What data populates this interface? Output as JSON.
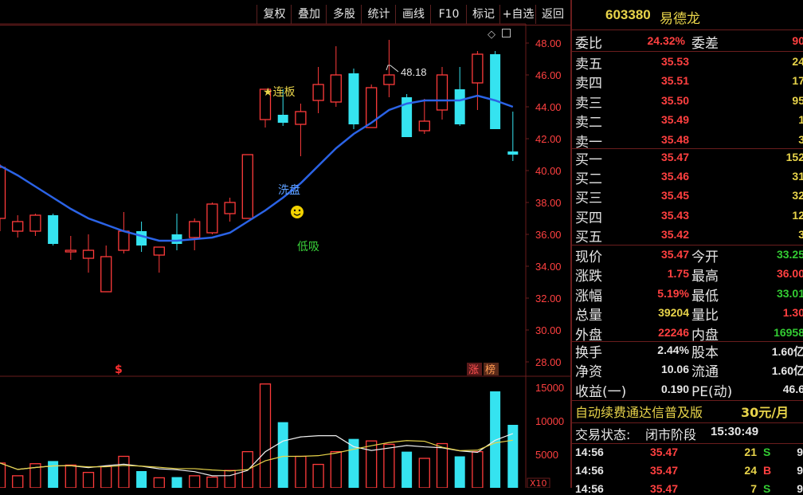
{
  "toolbar": {
    "items": [
      "复权",
      "叠加",
      "多股",
      "统计",
      "画线",
      "F10",
      "标记",
      "+自选",
      "返回"
    ]
  },
  "stock": {
    "code": "603380",
    "name": "易德龙"
  },
  "chart_data": {
    "type": "candlestick",
    "price_axis": {
      "ticks": [
        "48.00",
        "46.00",
        "44.00",
        "42.00",
        "40.00",
        "38.00",
        "36.00",
        "34.00",
        "32.00",
        "30.00",
        "28.00"
      ],
      "ylim": [
        27.2,
        49.2
      ]
    },
    "volume_axis": {
      "ticks": [
        "15000",
        "10000",
        "5000"
      ],
      "unit_label": "X10"
    },
    "candles": [
      {
        "o": 37.0,
        "h": 40.4,
        "l": 36.2,
        "c": 40.2
      },
      {
        "o": 36.2,
        "h": 37.2,
        "l": 35.8,
        "c": 36.8
      },
      {
        "o": 36.2,
        "h": 37.3,
        "l": 35.9,
        "c": 37.2
      },
      {
        "o": 37.2,
        "h": 37.3,
        "l": 35.3,
        "c": 35.4
      },
      {
        "o": 34.9,
        "h": 35.9,
        "l": 34.4,
        "c": 35.0
      },
      {
        "o": 34.5,
        "h": 36.0,
        "l": 33.6,
        "c": 35.0
      },
      {
        "o": 32.4,
        "h": 35.3,
        "l": 32.4,
        "c": 34.6
      },
      {
        "o": 35.0,
        "h": 37.4,
        "l": 34.8,
        "c": 36.2
      },
      {
        "o": 36.2,
        "h": 36.8,
        "l": 34.9,
        "c": 35.3
      },
      {
        "o": 34.7,
        "h": 35.2,
        "l": 33.6,
        "c": 35.2
      },
      {
        "o": 36.0,
        "h": 37.3,
        "l": 35.0,
        "c": 35.4
      },
      {
        "o": 35.8,
        "h": 37.0,
        "l": 35.0,
        "c": 36.8
      },
      {
        "o": 36.1,
        "h": 38.0,
        "l": 36.0,
        "c": 37.9
      },
      {
        "o": 37.3,
        "h": 38.3,
        "l": 36.8,
        "c": 38.0
      },
      {
        "o": 37.0,
        "h": 41.0,
        "l": 37.0,
        "c": 41.0
      },
      {
        "o": 43.2,
        "h": 45.1,
        "l": 42.7,
        "c": 45.1
      },
      {
        "o": 43.5,
        "h": 45.1,
        "l": 42.8,
        "c": 43.0
      },
      {
        "o": 42.9,
        "h": 44.2,
        "l": 40.9,
        "c": 43.7
      },
      {
        "o": 44.4,
        "h": 46.5,
        "l": 43.6,
        "c": 45.4
      },
      {
        "o": 44.3,
        "h": 47.8,
        "l": 44.0,
        "c": 46.0
      },
      {
        "o": 46.1,
        "h": 46.4,
        "l": 42.6,
        "c": 42.9
      },
      {
        "o": 42.7,
        "h": 45.4,
        "l": 42.7,
        "c": 45.2
      },
      {
        "o": 45.4,
        "h": 48.2,
        "l": 44.6,
        "c": 46.0
      },
      {
        "o": 44.6,
        "h": 44.8,
        "l": 42.1,
        "c": 42.1
      },
      {
        "o": 42.5,
        "h": 44.5,
        "l": 42.3,
        "c": 43.1
      },
      {
        "o": 43.8,
        "h": 46.5,
        "l": 43.2,
        "c": 46.0
      },
      {
        "o": 45.1,
        "h": 46.5,
        "l": 42.8,
        "c": 42.9
      },
      {
        "o": 45.5,
        "h": 47.5,
        "l": 43.8,
        "c": 47.3
      },
      {
        "o": 47.3,
        "h": 47.5,
        "l": 42.6,
        "c": 42.6
      },
      {
        "o": 41.2,
        "h": 43.7,
        "l": 40.6,
        "c": 41.0
      }
    ],
    "ma": [
      40.3,
      39.7,
      39.0,
      38.3,
      37.6,
      37.0,
      36.6,
      36.2,
      35.9,
      35.6,
      35.6,
      35.7,
      35.8,
      36.1,
      36.8,
      37.5,
      38.3,
      39.2,
      40.3,
      41.4,
      42.3,
      43.0,
      43.8,
      44.2,
      44.4,
      44.4,
      44.4,
      44.7,
      44.4,
      44.0
    ],
    "volumes": [
      3700,
      1800,
      3600,
      4000,
      3400,
      2300,
      3200,
      4700,
      2500,
      1500,
      1600,
      1800,
      1600,
      2600,
      5400,
      15500,
      9800,
      4700,
      3500,
      5400,
      7300,
      7000,
      6500,
      5400,
      4400,
      6600,
      4700,
      5400,
      14400,
      9400
    ],
    "annotations": {
      "high_label": "48.18",
      "limit_board": "★连板",
      "wash": "洗盘",
      "low_buy": "低吸",
      "zhang": "涨",
      "bang": "榜",
      "s_marker": "$"
    }
  },
  "quote": {
    "weibi": {
      "label": "委比",
      "value": "24.32%"
    },
    "weicha": {
      "label": "委差",
      "value": "90"
    },
    "asks": [
      {
        "label": "卖五",
        "price": "35.53",
        "vol": "24"
      },
      {
        "label": "卖四",
        "price": "35.51",
        "vol": "17"
      },
      {
        "label": "卖三",
        "price": "35.50",
        "vol": "95"
      },
      {
        "label": "卖二",
        "price": "35.49",
        "vol": "1"
      },
      {
        "label": "卖一",
        "price": "35.48",
        "vol": "3"
      }
    ],
    "bids": [
      {
        "label": "买一",
        "price": "35.47",
        "vol": "152"
      },
      {
        "label": "买二",
        "price": "35.46",
        "vol": "31"
      },
      {
        "label": "买三",
        "price": "35.45",
        "vol": "32"
      },
      {
        "label": "买四",
        "price": "35.43",
        "vol": "12"
      },
      {
        "label": "买五",
        "price": "35.42",
        "vol": "3"
      }
    ],
    "stats": [
      {
        "l1": "现价",
        "v1": "35.47",
        "c1": "red",
        "l2": "今开",
        "v2": "33.25",
        "c2": "green"
      },
      {
        "l1": "涨跌",
        "v1": "1.75",
        "c1": "red",
        "l2": "最高",
        "v2": "36.00",
        "c2": "red"
      },
      {
        "l1": "涨幅",
        "v1": "5.19%",
        "c1": "red",
        "l2": "最低",
        "v2": "33.01",
        "c2": "green"
      },
      {
        "l1": "总量",
        "v1": "39204",
        "c1": "yellow",
        "l2": "量比",
        "v2": "1.30",
        "c2": "red"
      },
      {
        "l1": "外盘",
        "v1": "22246",
        "c1": "red",
        "l2": "内盘",
        "v2": "16958",
        "c2": "green"
      }
    ],
    "fund": [
      {
        "l1": "换手",
        "v1": "2.44%",
        "l2": "股本",
        "v2": "1.60亿"
      },
      {
        "l1": "净资",
        "v1": "10.06",
        "l2": "流通",
        "v2": "1.60亿"
      },
      {
        "l1": "收益(一)",
        "v1": "0.190",
        "l2": "PE(动)",
        "v2": "46.6"
      }
    ],
    "promo": {
      "text": "自动续费通达信普及版",
      "price": "30元/月"
    },
    "trade_status": {
      "label": "交易状态:",
      "value": "闭市阶段",
      "time": "15:30:49"
    },
    "ticks": [
      {
        "time": "14:56",
        "price": "35.47",
        "vol": "21",
        "side": "S",
        "num": "9"
      },
      {
        "time": "14:56",
        "price": "35.47",
        "vol": "24",
        "side": "B",
        "num": "9"
      },
      {
        "time": "14:56",
        "price": "35.47",
        "vol": "7",
        "side": "S",
        "num": "9"
      }
    ]
  }
}
